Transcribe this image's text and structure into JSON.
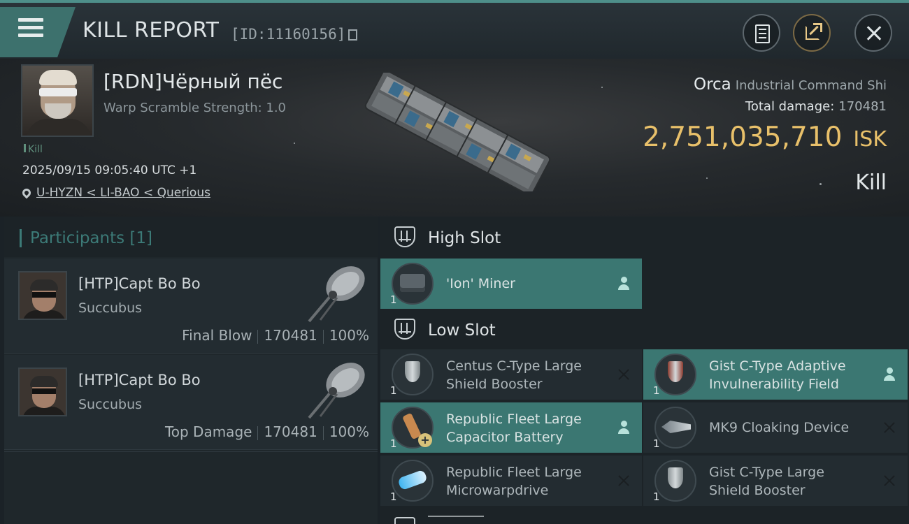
{
  "header": {
    "title": "KILL REPORT",
    "report_id": "[ID:11160156]"
  },
  "victim": {
    "name": "[RDN]Чёрный пёс",
    "warp_scramble": "Warp Scramble Strength: 1.0",
    "result_tag": "Kill",
    "datetime": "2025/09/15 09:05:40 UTC +1",
    "location": "U-HYZN < LI-BAO < Querious"
  },
  "ship": {
    "name": "Orca",
    "type": "Industrial Command Shi",
    "total_damage_label": "Total damage:",
    "total_damage": "170481",
    "isk_value": "2,751,035,710",
    "isk_unit": "ISK",
    "result": "Kill"
  },
  "participants": {
    "title": "Participants [1]",
    "rows": [
      {
        "name": "[HTP]Capt Bo Bo",
        "ship": "Succubus",
        "role": "Final Blow",
        "damage": "170481",
        "percent": "100%"
      },
      {
        "name": "[HTP]Capt Bo Bo",
        "ship": "Succubus",
        "role": "Top Damage",
        "damage": "170481",
        "percent": "100%"
      }
    ]
  },
  "fitting": {
    "high_slot": {
      "label": "High Slot",
      "items": [
        {
          "qty": "1",
          "name": "'Ion' Miner",
          "icon": "miner-icon",
          "status": "person-icon"
        }
      ]
    },
    "low_slot": {
      "label": "Low Slot",
      "items": [
        {
          "qty": "1",
          "name1": "Centus C-Type Large",
          "name2": "Shield Booster",
          "icon": "shield-icon",
          "status": "destroyed-x-icon"
        },
        {
          "qty": "1",
          "name1": "Gist C-Type Adaptive",
          "name2": "Invulnerability Field",
          "icon": "shield-icon",
          "status": "person-icon"
        },
        {
          "qty": "1",
          "name1": "Republic Fleet Large",
          "name2": "Capacitor Battery",
          "icon": "battery-icon",
          "status": "person-icon"
        },
        {
          "qty": "1",
          "name": "MK9 Cloaking Device",
          "icon": "cloak-icon",
          "status": "destroyed-x-icon"
        },
        {
          "qty": "1",
          "name1": "Republic Fleet Large",
          "name2": "Microwarpdrive",
          "icon": "mwd-icon",
          "status": "destroyed-x-icon"
        },
        {
          "qty": "1",
          "name1": "Gist C-Type Large",
          "name2": "Shield Booster",
          "icon": "shield-icon",
          "status": "destroyed-x-icon"
        }
      ]
    }
  },
  "colors": {
    "accent_teal": "#3b7772",
    "isk_gold": "#e8c06a"
  }
}
